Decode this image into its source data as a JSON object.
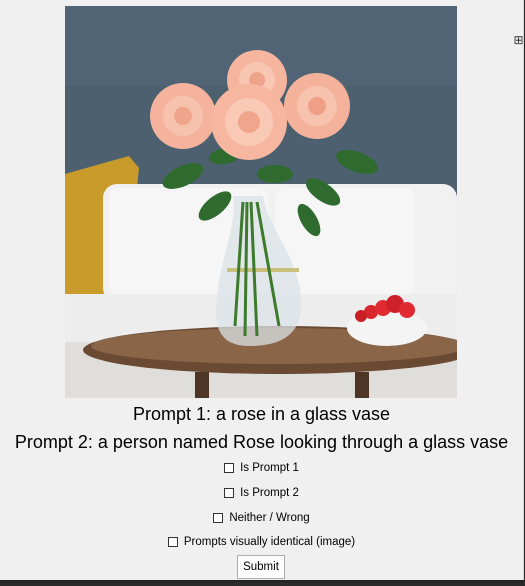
{
  "prompts": {
    "prompt1": "Prompt 1: a rose in a glass vase",
    "prompt2": "Prompt 2: a person named Rose looking through a glass vase"
  },
  "options": [
    {
      "label": "Is Prompt 1",
      "checked": false
    },
    {
      "label": "Is Prompt 2",
      "checked": false
    },
    {
      "label": "Neither / Wrong",
      "checked": false
    },
    {
      "label": "Prompts visually identical (image)",
      "checked": false
    }
  ],
  "submit_label": "Submit",
  "colors": {
    "wall": "#4d6070",
    "rose": "#f5b39d",
    "sofa": "#f2f2f2",
    "pillow": "#c99b2b",
    "table": "#6b4a34"
  }
}
